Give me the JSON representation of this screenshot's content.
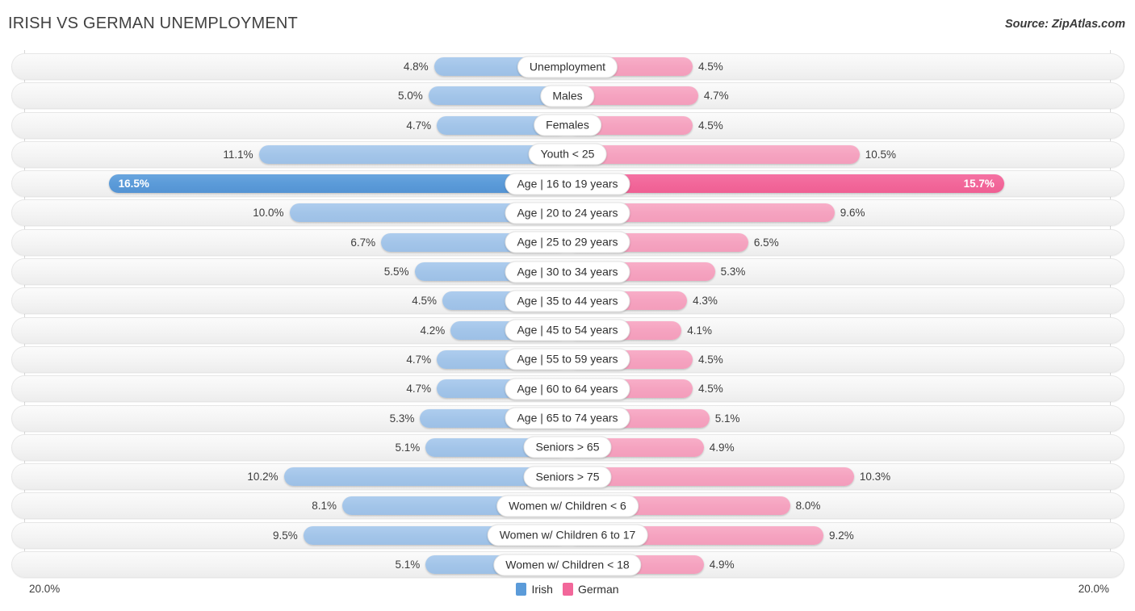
{
  "header": {
    "title": "IRISH VS GERMAN UNEMPLOYMENT",
    "source": "Source: ZipAtlas.com"
  },
  "axis": {
    "min_label": "20.0%",
    "max_label": "20.0%",
    "scale_max": 20.0
  },
  "legend": {
    "items": [
      {
        "label": "Irish",
        "color": "#5b9bd9"
      },
      {
        "label": "German",
        "color": "#f2679a"
      }
    ]
  },
  "colors": {
    "irish_light": "#a3c5e9",
    "irish_dark": "#5b9bd9",
    "german_light": "#f5a3c0",
    "german_dark": "#f2679a",
    "track": "#f4f4f4",
    "text": "#3d3d3d"
  },
  "chart_data": {
    "type": "bar",
    "subtype": "diverging-paired-bar",
    "title": "IRISH VS GERMAN UNEMPLOYMENT",
    "source": "Source: ZipAtlas.com",
    "xlabel": "",
    "ylabel": "",
    "xlim": [
      20.0,
      20.0
    ],
    "grid": false,
    "legend_position": "bottom-center",
    "series": [
      {
        "name": "Irish",
        "color": "#a3c5e9",
        "side": "left",
        "values": [
          4.8,
          5.0,
          4.7,
          11.1,
          16.5,
          10.0,
          6.7,
          5.5,
          4.5,
          4.2,
          4.7,
          4.7,
          5.3,
          5.1,
          10.2,
          8.1,
          9.5,
          5.1
        ]
      },
      {
        "name": "German",
        "color": "#f5a3c0",
        "side": "right",
        "values": [
          4.5,
          4.7,
          4.5,
          10.5,
          15.7,
          9.6,
          6.5,
          5.3,
          4.3,
          4.1,
          4.5,
          4.5,
          5.1,
          4.9,
          10.3,
          8.0,
          9.2,
          4.9
        ]
      }
    ],
    "categories": [
      "Unemployment",
      "Males",
      "Females",
      "Youth < 25",
      "Age | 16 to 19 years",
      "Age | 20 to 24 years",
      "Age | 25 to 29 years",
      "Age | 30 to 34 years",
      "Age | 35 to 44 years",
      "Age | 45 to 54 years",
      "Age | 55 to 59 years",
      "Age | 60 to 64 years",
      "Age | 65 to 74 years",
      "Seniors > 65",
      "Seniors > 75",
      "Women w/ Children < 6",
      "Women w/ Children 6 to 17",
      "Women w/ Children < 18"
    ]
  },
  "rows": [
    {
      "label": "Unemployment",
      "left_value": "4.8%",
      "right_value": "4.5%",
      "left_num": 4.8,
      "right_num": 4.5,
      "highlight": false
    },
    {
      "label": "Males",
      "left_value": "5.0%",
      "right_value": "4.7%",
      "left_num": 5.0,
      "right_num": 4.7,
      "highlight": false
    },
    {
      "label": "Females",
      "left_value": "4.7%",
      "right_value": "4.5%",
      "left_num": 4.7,
      "right_num": 4.5,
      "highlight": false
    },
    {
      "label": "Youth < 25",
      "left_value": "11.1%",
      "right_value": "10.5%",
      "left_num": 11.1,
      "right_num": 10.5,
      "highlight": false
    },
    {
      "label": "Age | 16 to 19 years",
      "left_value": "16.5%",
      "right_value": "15.7%",
      "left_num": 16.5,
      "right_num": 15.7,
      "highlight": true
    },
    {
      "label": "Age | 20 to 24 years",
      "left_value": "10.0%",
      "right_value": "9.6%",
      "left_num": 10.0,
      "right_num": 9.6,
      "highlight": false
    },
    {
      "label": "Age | 25 to 29 years",
      "left_value": "6.7%",
      "right_value": "6.5%",
      "left_num": 6.7,
      "right_num": 6.5,
      "highlight": false
    },
    {
      "label": "Age | 30 to 34 years",
      "left_value": "5.5%",
      "right_value": "5.3%",
      "left_num": 5.5,
      "right_num": 5.3,
      "highlight": false
    },
    {
      "label": "Age | 35 to 44 years",
      "left_value": "4.5%",
      "right_value": "4.3%",
      "left_num": 4.5,
      "right_num": 4.3,
      "highlight": false
    },
    {
      "label": "Age | 45 to 54 years",
      "left_value": "4.2%",
      "right_value": "4.1%",
      "left_num": 4.2,
      "right_num": 4.1,
      "highlight": false
    },
    {
      "label": "Age | 55 to 59 years",
      "left_value": "4.7%",
      "right_value": "4.5%",
      "left_num": 4.7,
      "right_num": 4.5,
      "highlight": false
    },
    {
      "label": "Age | 60 to 64 years",
      "left_value": "4.7%",
      "right_value": "4.5%",
      "left_num": 4.7,
      "right_num": 4.5,
      "highlight": false
    },
    {
      "label": "Age | 65 to 74 years",
      "left_value": "5.3%",
      "right_value": "5.1%",
      "left_num": 5.3,
      "right_num": 5.1,
      "highlight": false
    },
    {
      "label": "Seniors > 65",
      "left_value": "5.1%",
      "right_value": "4.9%",
      "left_num": 5.1,
      "right_num": 4.9,
      "highlight": false
    },
    {
      "label": "Seniors > 75",
      "left_value": "10.2%",
      "right_value": "10.3%",
      "left_num": 10.2,
      "right_num": 10.3,
      "highlight": false
    },
    {
      "label": "Women w/ Children < 6",
      "left_value": "8.1%",
      "right_value": "8.0%",
      "left_num": 8.1,
      "right_num": 8.0,
      "highlight": false
    },
    {
      "label": "Women w/ Children 6 to 17",
      "left_value": "9.5%",
      "right_value": "9.2%",
      "left_num": 9.5,
      "right_num": 9.2,
      "highlight": false
    },
    {
      "label": "Women w/ Children < 18",
      "left_value": "5.1%",
      "right_value": "4.9%",
      "left_num": 5.1,
      "right_num": 4.9,
      "highlight": false
    }
  ]
}
